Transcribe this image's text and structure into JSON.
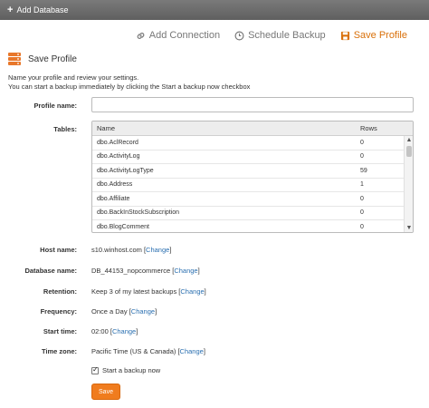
{
  "window": {
    "title": "Add Database"
  },
  "nav": {
    "add_connection": "Add Connection",
    "schedule_backup": "Schedule Backup",
    "save_profile": "Save Profile",
    "active_color": "#d9700a"
  },
  "section": {
    "title": "Save Profile"
  },
  "description": {
    "line1": "Name your profile and review your settings.",
    "line2": "You can start a backup immediately by clicking the Start a backup now checkbox"
  },
  "form": {
    "profile_name_label": "Profile name:",
    "profile_name_value": "",
    "tables_label": "Tables:",
    "table_headers": {
      "name": "Name",
      "rows": "Rows"
    },
    "tables": [
      {
        "name": "dbo.AclRecord",
        "rows": "0"
      },
      {
        "name": "dbo.ActivityLog",
        "rows": "0"
      },
      {
        "name": "dbo.ActivityLogType",
        "rows": "59"
      },
      {
        "name": "dbo.Address",
        "rows": "1"
      },
      {
        "name": "dbo.Affiliate",
        "rows": "0"
      },
      {
        "name": "dbo.BackInStockSubscription",
        "rows": "0"
      },
      {
        "name": "dbo.BlogComment",
        "rows": "0"
      }
    ],
    "host": {
      "label": "Host name:",
      "value": "s10.winhost.com",
      "change": "Change"
    },
    "database": {
      "label": "Database name:",
      "value": "DB_44153_nopcommerce",
      "change": "Change"
    },
    "retention": {
      "label": "Retention:",
      "value": "Keep 3 of my latest backups",
      "change": "Change"
    },
    "frequency": {
      "label": "Frequency:",
      "value": "Once a Day",
      "change": "Change"
    },
    "start_time": {
      "label": "Start time:",
      "value": "02:00",
      "change": "Change"
    },
    "time_zone": {
      "label": "Time zone:",
      "value": "Pacific Time (US & Canada)",
      "change": "Change"
    },
    "start_now": {
      "label": "Start a backup now",
      "checked": true
    },
    "save_button": "Save"
  }
}
